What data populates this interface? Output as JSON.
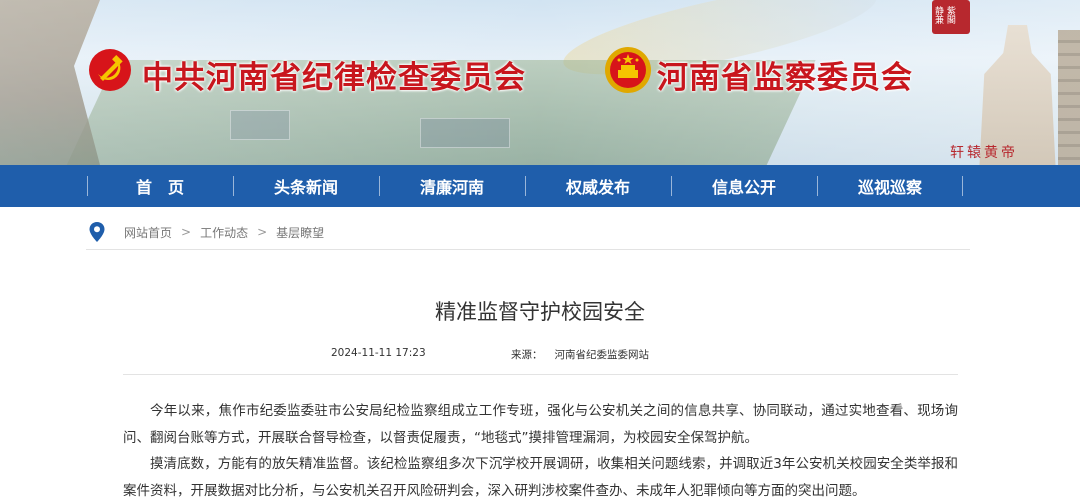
{
  "header": {
    "title_left": "中共河南省纪律检查委员会",
    "title_right": "河南省监察委员会",
    "seal_text": "静 紫 兼 閣",
    "calligraphy": "轩辕黄帝"
  },
  "nav": {
    "items": [
      {
        "label": "首　页"
      },
      {
        "label": "头条新闻"
      },
      {
        "label": "清廉河南"
      },
      {
        "label": "权威发布"
      },
      {
        "label": "信息公开"
      },
      {
        "label": "巡视巡察"
      }
    ]
  },
  "breadcrumb": {
    "items": [
      {
        "label": "网站首页"
      },
      {
        "label": "工作动态"
      },
      {
        "label": "基层瞭望"
      }
    ],
    "separator": ">"
  },
  "article": {
    "title": "精准监督守护校园安全",
    "date": "2024-11-11 17:23",
    "source_label": "来源：",
    "source": "河南省纪委监委网站",
    "paragraphs": [
      "今年以来，焦作市纪委监委驻市公安局纪检监察组成立工作专班，强化与公安机关之间的信息共享、协同联动，通过实地查看、现场询问、翻阅台账等方式，开展联合督导检查，以督责促履责，“地毯式”摸排管理漏洞，为校园安全保驾护航。",
      "摸清底数，方能有的放矢精准监督。该纪检监察组多次下沉学校开展调研，收集相关问题线索，并调取近3年公安机关校园安全类举报和案件资料，开展数据对比分析，与公安机关召开风险研判会，深入研判涉校案件查办、未成年人犯罪倾向等方面的突出问题。"
    ]
  },
  "colors": {
    "nav_bg": "#1f5eab",
    "title_red": "#c8161d"
  }
}
